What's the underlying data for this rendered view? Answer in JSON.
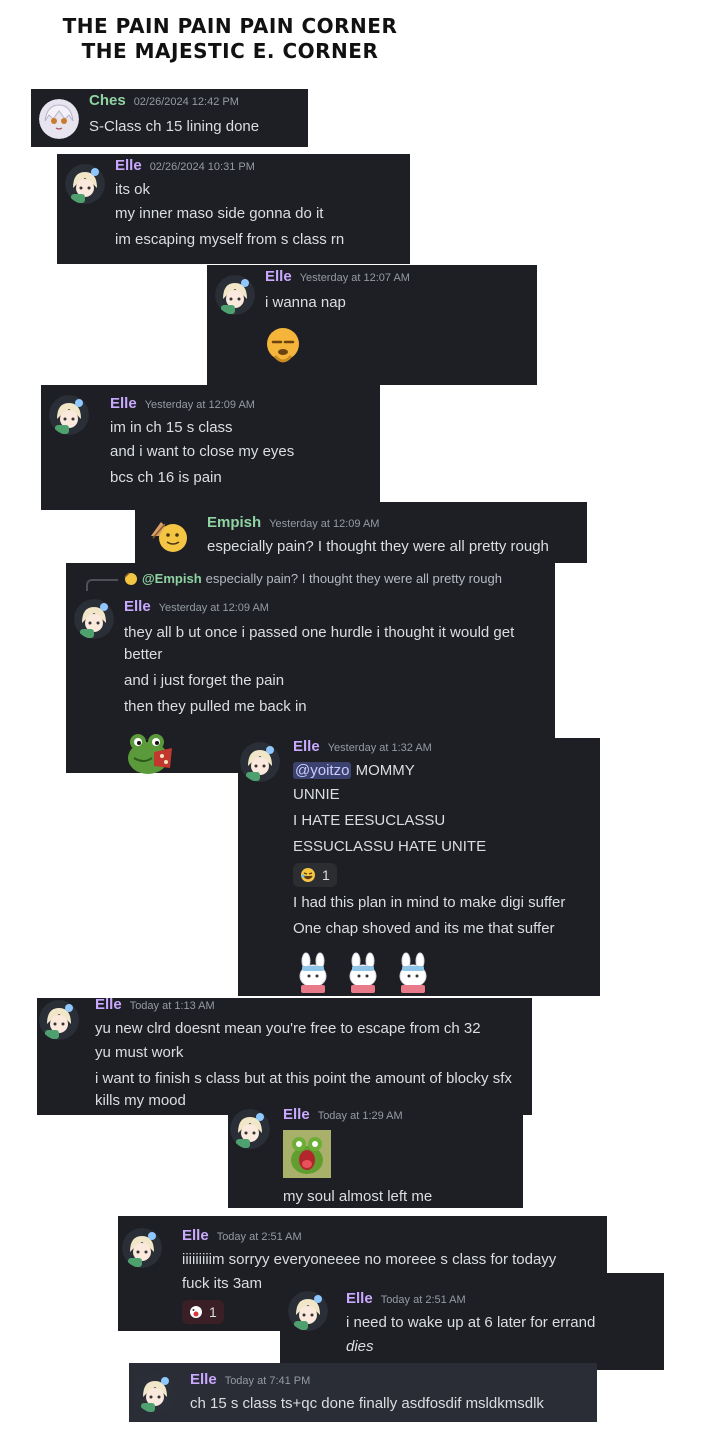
{
  "header": {
    "line1": "THE PAIN PAIN PAIN CORNER",
    "line2": "THE MAJESTIC E. CORNER"
  },
  "colors": {
    "message_bg": "#1e1f24",
    "username_elle": "#c8a9ff",
    "username_green": "#8fd3a3",
    "timestamp": "#949ba4",
    "text": "#dbdee1",
    "mention_bg": "#3c4270"
  },
  "messages": [
    {
      "author": "Ches",
      "time": "02/26/2024 12:42 PM",
      "lines": [
        "S-Class ch 15 lining done"
      ]
    },
    {
      "author": "Elle",
      "time": "02/26/2024 10:31 PM",
      "lines": [
        "its ok",
        "my inner maso side gonna do it",
        "im escaping myself from s class rn"
      ]
    },
    {
      "author": "Elle",
      "time": "Yesterday at 12:07 AM",
      "lines": [
        "i wanna nap"
      ],
      "emoji": "sleepy-face-emoji"
    },
    {
      "author": "Elle",
      "time": "Yesterday at 12:09 AM",
      "lines": [
        "im in ch 15 s class",
        "and i want to close my eyes",
        "bcs ch 16 is pain"
      ]
    },
    {
      "author": "Empish",
      "time": "Yesterday at 12:09 AM",
      "lines": [
        "especially pain? I thought they were all pretty rough"
      ]
    },
    {
      "reply": {
        "name": "@Empish",
        "text": "especially pain? I thought they were all pretty rough"
      },
      "author": "Elle",
      "time": "Yesterday at 12:09 AM",
      "lines": [
        "they all  b ut once i passed one hurdle i thought it would get better",
        "and i just forget the pain",
        "then they pulled me back in"
      ],
      "emoji": "frog-emoji"
    },
    {
      "author": "Elle",
      "time": "Yesterday at 1:32 AM",
      "mention": "@yoitzo",
      "first_line_rest": " MOMMY",
      "lines": [
        "UNNIE",
        "I HATE EESUCLASSU",
        "ESSUCLASSU HATE UNITE"
      ],
      "reaction": {
        "emoji": "rolling-laugh-emoji",
        "count": "1"
      },
      "lines_after": [
        "I had this plan in mind to make digi suffer",
        "One chap shoved and its me that suffer"
      ],
      "stickers": [
        "bunny-sticker",
        "bunny-sticker",
        "bunny-sticker"
      ]
    },
    {
      "author": "Elle",
      "time": "Today at 1:13 AM",
      "lines": [
        "yu new clrd doesnt mean you're free to escape from ch 32",
        "yu must work",
        "i want to finish s class but at this point the amount of blocky sfx kills my mood"
      ]
    },
    {
      "author": "Elle",
      "time": "Today at 1:29 AM",
      "image": "kermit-scream-gif",
      "lines": [
        "my soul almost left me"
      ]
    },
    {
      "author": "Elle",
      "time": "Today at 2:51 AM",
      "lines": [
        "iiiiiiiiim sorryy everyoneeee no moreee s class for todayy",
        "fuck its 3am"
      ],
      "reaction": {
        "emoji": "blushing-face-emoji",
        "count": "1"
      }
    },
    {
      "author": "Elle",
      "time": "Today at 2:51 AM",
      "lines": [
        "i need to wake up at 6 later for errand",
        "dies"
      ]
    },
    {
      "author": "Elle",
      "time": "Today at 7:41 PM",
      "lines": [
        "ch 15 s class ts+qc done finally asdfosdif msldkmsdlk"
      ]
    }
  ]
}
